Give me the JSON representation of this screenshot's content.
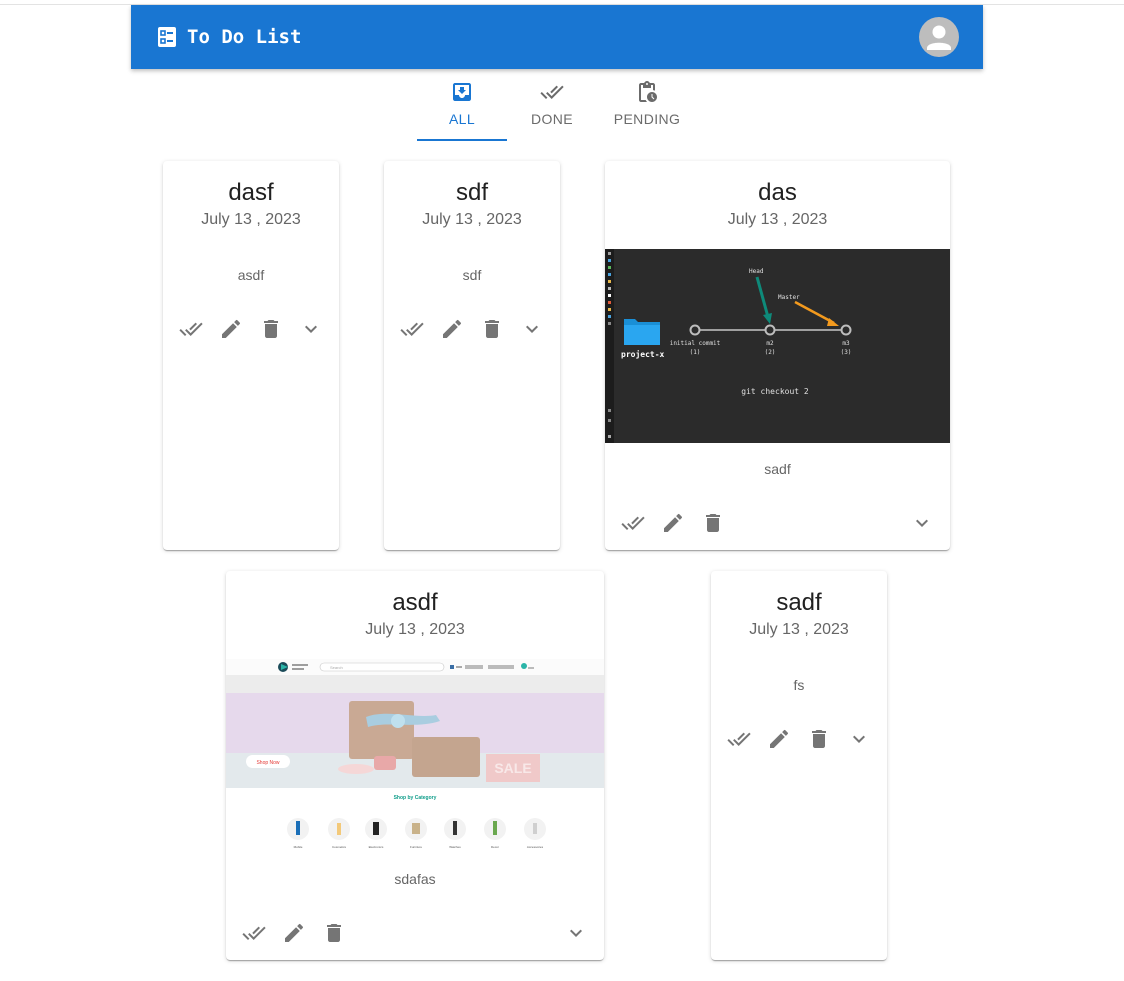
{
  "app": {
    "title": "To Do List",
    "accent": "#1976d2",
    "icon": "checklist-icon",
    "avatar_icon": "account-circle-icon"
  },
  "tabs": [
    {
      "label": "ALL",
      "icon": "inbox-icon",
      "active": true
    },
    {
      "label": "DONE",
      "icon": "done-all-icon",
      "active": false
    },
    {
      "label": "PENDING",
      "icon": "pending-actions-icon",
      "active": false
    }
  ],
  "todos": [
    {
      "title": "dasf",
      "date": "July 13 , 2023",
      "description": "asdf",
      "image": null
    },
    {
      "title": "sdf",
      "date": "July 13 , 2023",
      "description": "sdf",
      "image": null
    },
    {
      "title": "das",
      "date": "July 13 , 2023",
      "description": "sadf",
      "image": {
        "type": "git-screenshot",
        "folder_label": "project-x",
        "head_label": "Head",
        "master_label": "Master",
        "commits": [
          {
            "name": "initial commit",
            "num": "(1)"
          },
          {
            "name": "m2",
            "num": "(2)"
          },
          {
            "name": "m3",
            "num": "(3)"
          }
        ],
        "command": "git checkout 2"
      }
    },
    {
      "title": "asdf",
      "date": "July 13 , 2023",
      "description": "sdafas",
      "image": {
        "type": "shop-screenshot",
        "search_placeholder": "Search",
        "button_label": "Shop Now",
        "banner_text": "SALE",
        "section_title": "Shop by Category",
        "categories": [
          "Mobile",
          "Cosmetics",
          "Electronics",
          "Furniture",
          "Watches",
          "Decor",
          "Accessories"
        ]
      }
    },
    {
      "title": "sadf",
      "date": "July 13 , 2023",
      "description": "fs",
      "image": null
    }
  ],
  "actions": {
    "complete_icon": "done-all-icon",
    "edit_icon": "edit-icon",
    "delete_icon": "delete-icon",
    "expand_icon": "expand-more-icon"
  }
}
